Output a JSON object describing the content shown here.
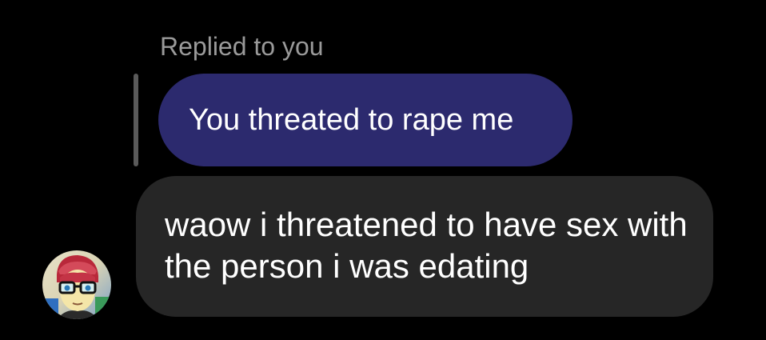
{
  "reply": {
    "label": "Replied to you",
    "quoted_text": "You threated to rape me"
  },
  "message": {
    "text": "waow i threatened to have sex with the person i was edating"
  },
  "colors": {
    "background": "#000000",
    "reply_bubble": "#2c2a6e",
    "message_bubble": "#262626",
    "reply_label": "#9a9a9a"
  },
  "icons": {
    "avatar": "user-avatar-anime-glasses"
  }
}
